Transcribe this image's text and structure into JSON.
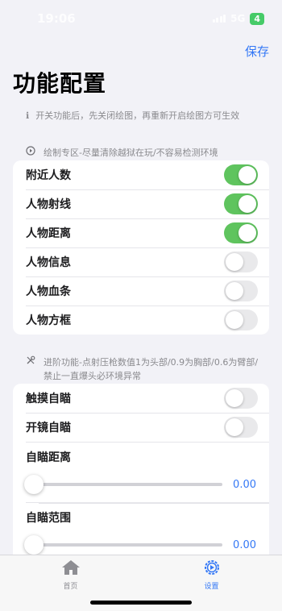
{
  "status_bar": {
    "time": "19:06",
    "network": "5G",
    "battery": "4"
  },
  "header": {
    "save_label": "保存",
    "title": "功能配置"
  },
  "info": {
    "icon": "info-icon",
    "text": "开关功能后，先关闭绘图，再重新开启绘图方可生效"
  },
  "draw_section": {
    "header_text": "绘制专区-尽量清除越狱在玩/不容易检测环境",
    "icon": "play-circle-icon",
    "items": [
      {
        "label": "附近人数",
        "on": true
      },
      {
        "label": "人物射线",
        "on": true
      },
      {
        "label": "人物距离",
        "on": true
      },
      {
        "label": "人物信息",
        "on": false
      },
      {
        "label": "人物血条",
        "on": false
      },
      {
        "label": "人物方框",
        "on": false
      }
    ]
  },
  "advanced_section": {
    "header_text": "进阶功能-点射压枪数值1为头部/0.9为胸部/0.6为臂部/禁止一直爆头必环境异常",
    "icon": "tools-icon",
    "toggles": [
      {
        "label": "触摸自瞄",
        "on": false
      },
      {
        "label": "开镜自瞄",
        "on": false
      }
    ],
    "sliders": [
      {
        "label": "自瞄距离",
        "value": "0.00"
      },
      {
        "label": "自瞄范围",
        "value": "0.00"
      }
    ]
  },
  "tabs": [
    {
      "label": "首页",
      "icon": "home-icon",
      "active": false
    },
    {
      "label": "设置",
      "icon": "gear-icon",
      "active": true
    }
  ],
  "colors": {
    "accent": "#3478f6",
    "toggle_on": "#5fc45e",
    "background": "#f2f2f7"
  }
}
